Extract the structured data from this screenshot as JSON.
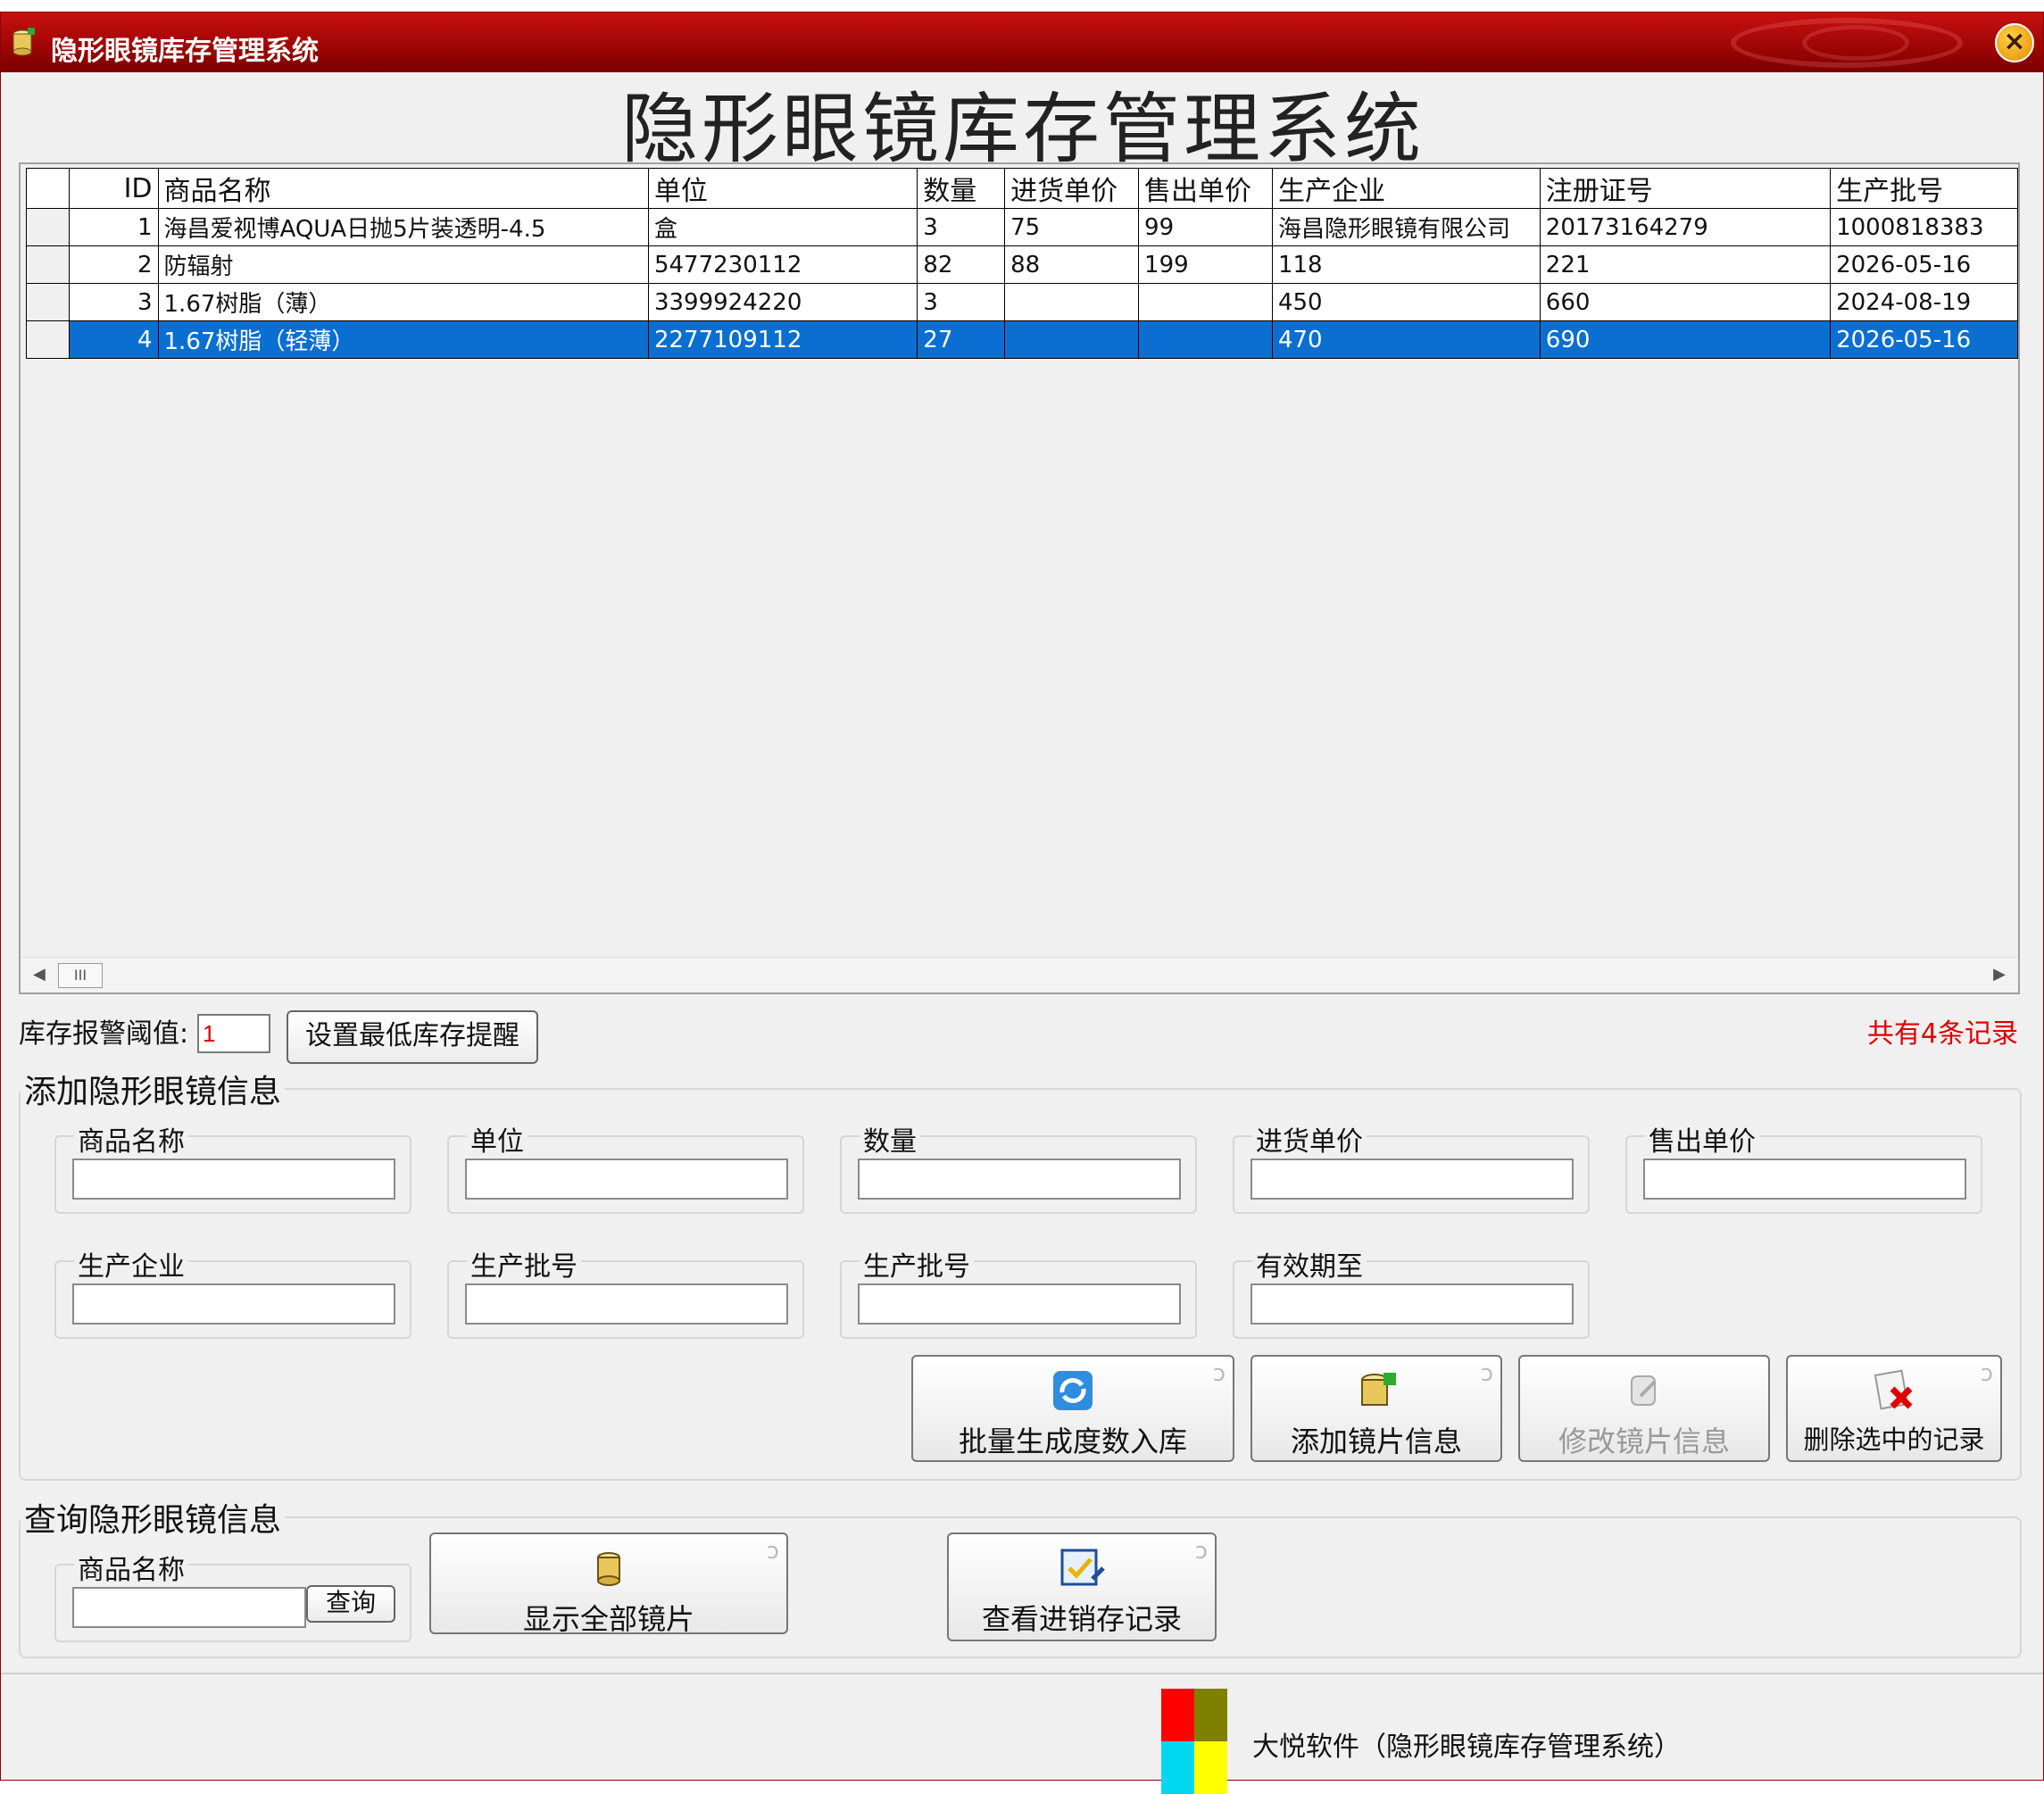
{
  "window": {
    "title": "隐形眼镜库存管理系统",
    "close_label": "×"
  },
  "header": {
    "title": "隐形眼镜库存管理系统"
  },
  "table": {
    "columns": [
      "ID",
      "商品名称",
      "单位",
      "数量",
      "进货单价",
      "售出单价",
      "生产企业",
      "注册证号",
      "生产批号"
    ],
    "rows": [
      [
        "1",
        "海昌爱视博AQUA日抛5片装透明-4.5",
        "盒",
        "3",
        "75",
        "99",
        "海昌隐形眼镜有限公司",
        "20173164279",
        "1000818383"
      ],
      [
        "2",
        "防辐射",
        "5477230112",
        "82",
        "88",
        "199",
        "118",
        "221",
        "2026-05-16"
      ],
      [
        "3",
        "1.67树脂（薄）",
        "3399924220",
        "3",
        "",
        "",
        "450",
        "660",
        "2024-08-19"
      ],
      [
        "4",
        "1.67树脂（轻薄）",
        "2277109112",
        "27",
        "",
        "",
        "470",
        "690",
        "2026-05-16"
      ]
    ],
    "selected_row": 4,
    "scroll_thumb": "III"
  },
  "alarm": {
    "label": "库存报警阈值:",
    "value": "1",
    "button": "设置最低库存提醒"
  },
  "record_count": "共有4条记录",
  "add_form": {
    "legend": "添加隐形眼镜信息",
    "fields": [
      "商品名称",
      "单位",
      "数量",
      "进货单价",
      "售出单价",
      "生产企业",
      "生产批号",
      "生产批号",
      "有效期至"
    ],
    "buttons": {
      "batch": "批量生成度数入库",
      "add": "添加镜片信息",
      "edit": "修改镜片信息",
      "delete": "删除选中的记录"
    }
  },
  "query": {
    "legend": "查询隐形眼镜信息",
    "field_label": "商品名称",
    "search_button": "查询",
    "show_all": "显示全部镜片",
    "view_records": "查看进销存记录"
  },
  "status": {
    "company": "大悦软件（隐形眼镜库存管理系统）"
  },
  "colors": {
    "title_bar": "#b00a0a",
    "selection": "#0b6fd1",
    "count_text": "#e00000"
  },
  "icons": {
    "app": "database-add-icon",
    "close": "close-icon",
    "batch": "refresh-icon",
    "add": "database-add-icon",
    "edit": "edit-icon",
    "delete": "delete-icon",
    "show_all": "database-icon",
    "records": "checklist-icon"
  }
}
